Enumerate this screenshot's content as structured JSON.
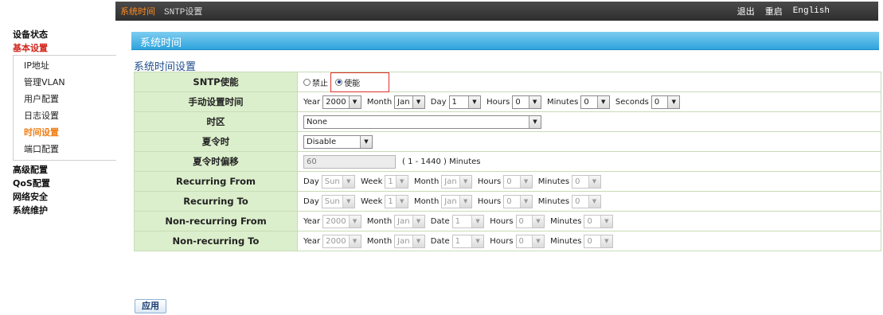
{
  "top_nav": {
    "active": "系统时间",
    "item": "SNTP设置"
  },
  "top_links": {
    "logout": "退出",
    "reboot": "重启",
    "language": "English"
  },
  "sidebar": {
    "device_status": "设备状态",
    "basic_settings": "基本设置",
    "sub_items": [
      "IP地址",
      "管理VLAN",
      "用户配置",
      "日志设置",
      "时间设置",
      "端口配置"
    ],
    "advanced": "高级配置",
    "qos": "QoS配置",
    "security": "网络安全",
    "maintenance": "系统维护"
  },
  "title_band": "系统时间",
  "section_title": "系统时间设置",
  "rows": {
    "sntp": {
      "label": "SNTP使能",
      "opt_disable": "禁止",
      "opt_enable": "使能",
      "selected": "使能"
    },
    "manual": {
      "label": "手动设置时间",
      "year_label": "Year",
      "year": "2000",
      "month_label": "Month",
      "month": "Jan",
      "day_label": "Day",
      "day": "1",
      "hours_label": "Hours",
      "hours": "0",
      "minutes_label": "Minutes",
      "minutes": "0",
      "seconds_label": "Seconds",
      "seconds": "0"
    },
    "timezone": {
      "label": "时区",
      "value": "None"
    },
    "dst": {
      "label": "夏令时",
      "value": "Disable"
    },
    "dst_offset": {
      "label": "夏令时偏移",
      "value": "60",
      "hint": "( 1 - 1440 ) Minutes"
    },
    "rec_from": {
      "label": "Recurring From",
      "day_label": "Day",
      "day": "Sun",
      "week_label": "Week",
      "week": "1",
      "month_label": "Month",
      "month": "Jan",
      "hours_label": "Hours",
      "hours": "0",
      "minutes_label": "Minutes",
      "minutes": "0"
    },
    "rec_to": {
      "label": "Recurring To",
      "day_label": "Day",
      "day": "Sun",
      "week_label": "Week",
      "week": "1",
      "month_label": "Month",
      "month": "Jan",
      "hours_label": "Hours",
      "hours": "0",
      "minutes_label": "Minutes",
      "minutes": "0"
    },
    "nonrec_from": {
      "label": "Non-recurring From",
      "year_label": "Year",
      "year": "2000",
      "month_label": "Month",
      "month": "Jan",
      "date_label": "Date",
      "date": "1",
      "hours_label": "Hours",
      "hours": "0",
      "minutes_label": "Minutes",
      "minutes": "0"
    },
    "nonrec_to": {
      "label": "Non-recurring To",
      "year_label": "Year",
      "year": "2000",
      "month_label": "Month",
      "month": "Jan",
      "date_label": "Date",
      "date": "1",
      "hours_label": "Hours",
      "hours": "0",
      "minutes_label": "Minutes",
      "minutes": "0"
    }
  },
  "apply_label": "应用",
  "colors": {
    "title_band": "#2fa3dd",
    "label_bg": "#dcefcc",
    "active_nav": "#ff8a1e",
    "highlight_box": "#e0302a"
  }
}
